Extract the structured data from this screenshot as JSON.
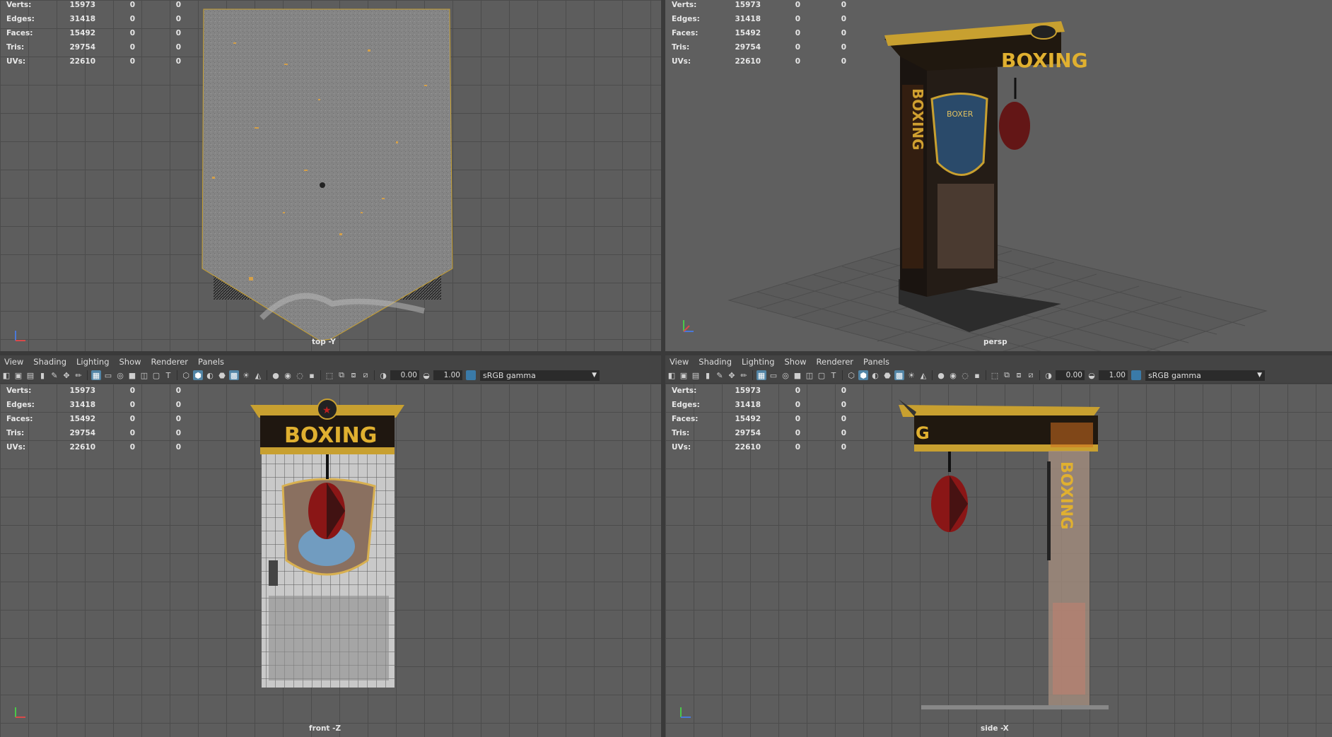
{
  "menu": [
    "View",
    "Shading",
    "Lighting",
    "Show",
    "Renderer",
    "Panels"
  ],
  "toolbar": {
    "exposure": "0.00",
    "gamma": "1.00",
    "color_space": "sRGB gamma"
  },
  "hud": {
    "rows": [
      {
        "label": "Verts:",
        "v1": "15973",
        "v2": "0",
        "v3": "0"
      },
      {
        "label": "Edges:",
        "v1": "31418",
        "v2": "0",
        "v3": "0"
      },
      {
        "label": "Faces:",
        "v1": "15492",
        "v2": "0",
        "v3": "0"
      },
      {
        "label": "Tris:",
        "v1": "29754",
        "v2": "0",
        "v3": "0"
      },
      {
        "label": "UVs:",
        "v1": "22610",
        "v2": "0",
        "v3": "0"
      }
    ]
  },
  "viewports": {
    "top": {
      "camera": "top -Y"
    },
    "persp": {
      "camera": "persp"
    },
    "front": {
      "camera": "front -Z"
    },
    "side": {
      "camera": "side -X"
    }
  },
  "model": {
    "sign_text": "BOXING",
    "panel_text": "BOXER"
  },
  "colors": {
    "accent": "#5285a6",
    "gold": "#c8a030",
    "grid": "#4c4c4c"
  }
}
